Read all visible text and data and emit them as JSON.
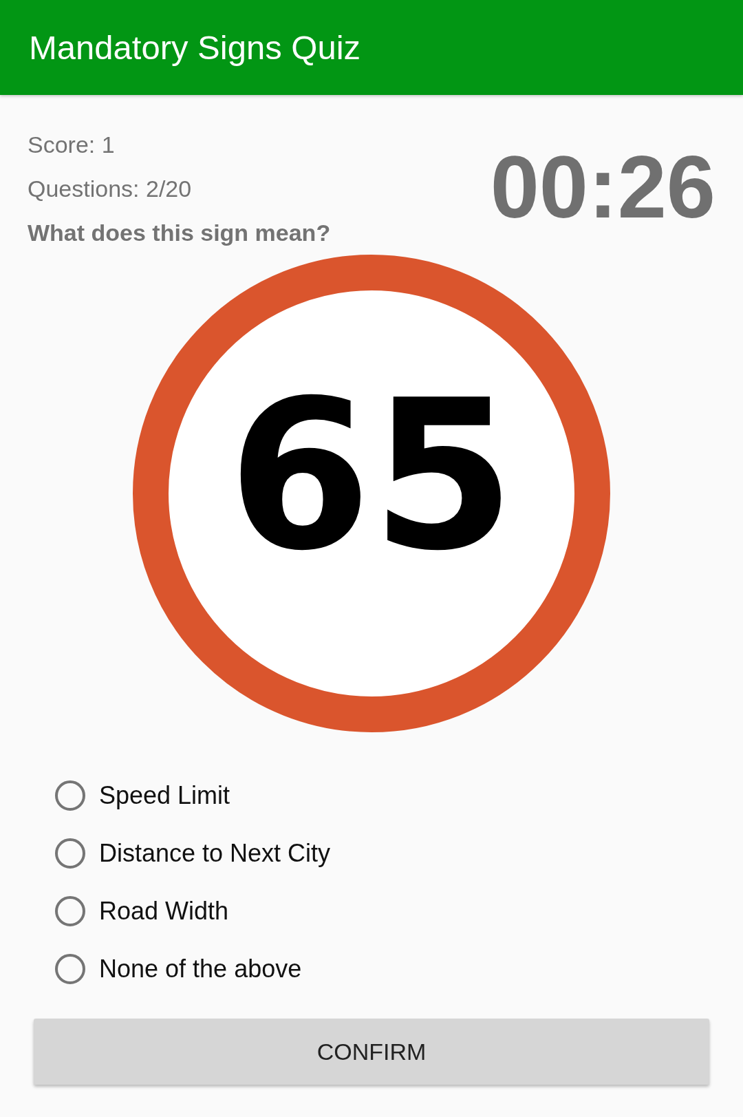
{
  "app_bar": {
    "title": "Mandatory Signs Quiz"
  },
  "score": "Score: 1",
  "questions": "Questions: 2/20",
  "timer": "00:26",
  "question": "What does this sign mean?",
  "sign": {
    "text": "65"
  },
  "options": [
    {
      "label": "Speed Limit",
      "selected": false
    },
    {
      "label": "Distance to Next City",
      "selected": false
    },
    {
      "label": "Road Width",
      "selected": false
    },
    {
      "label": "None of the above",
      "selected": false
    }
  ],
  "confirm_button": "CONFIRM"
}
